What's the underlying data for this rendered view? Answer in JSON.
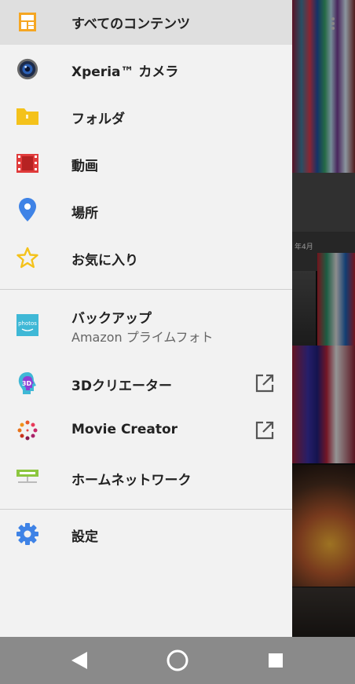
{
  "drawer": {
    "items": [
      {
        "label": "すべてのコンテンツ",
        "icon": "all-content-icon"
      },
      {
        "label": "Xperia™ カメラ",
        "icon": "camera-icon"
      },
      {
        "label": "フォルダ",
        "icon": "folder-icon"
      },
      {
        "label": "動画",
        "icon": "video-film-icon"
      },
      {
        "label": "場所",
        "icon": "location-pin-icon"
      },
      {
        "label": "お気に入り",
        "icon": "star-icon"
      }
    ],
    "services": [
      {
        "label": "バックアップ",
        "sublabel": "Amazon プライムフォト",
        "icon": "amazon-photos-icon",
        "icon_text": "photos"
      },
      {
        "label": "3Dクリエーター",
        "icon": "3d-creator-icon",
        "icon_text": "3D"
      },
      {
        "label": "Movie Creator",
        "icon": "movie-creator-icon"
      },
      {
        "label": "ホームネットワーク",
        "icon": "home-network-icon"
      }
    ],
    "settings": {
      "label": "設定",
      "icon": "settings-gear-icon"
    }
  },
  "background": {
    "date_label": "年4月"
  },
  "colors": {
    "drawer_bg": "#f2f2f2",
    "active_bg": "#dfdfdf",
    "navbar_bg": "#8a8a8a",
    "accent_orange": "#f5a623",
    "camera_blue": "#2b5fb4",
    "folder_yellow": "#f4c21b",
    "video_red": "#e03b3b",
    "pin_blue": "#3f83e6",
    "star_yellow": "#f4c21b",
    "photos_teal": "#3fb8d6",
    "gear_blue": "#3f83e6"
  },
  "navbar": {
    "back": "back-triangle-icon",
    "home": "home-circle-icon",
    "recents": "recents-square-icon"
  }
}
